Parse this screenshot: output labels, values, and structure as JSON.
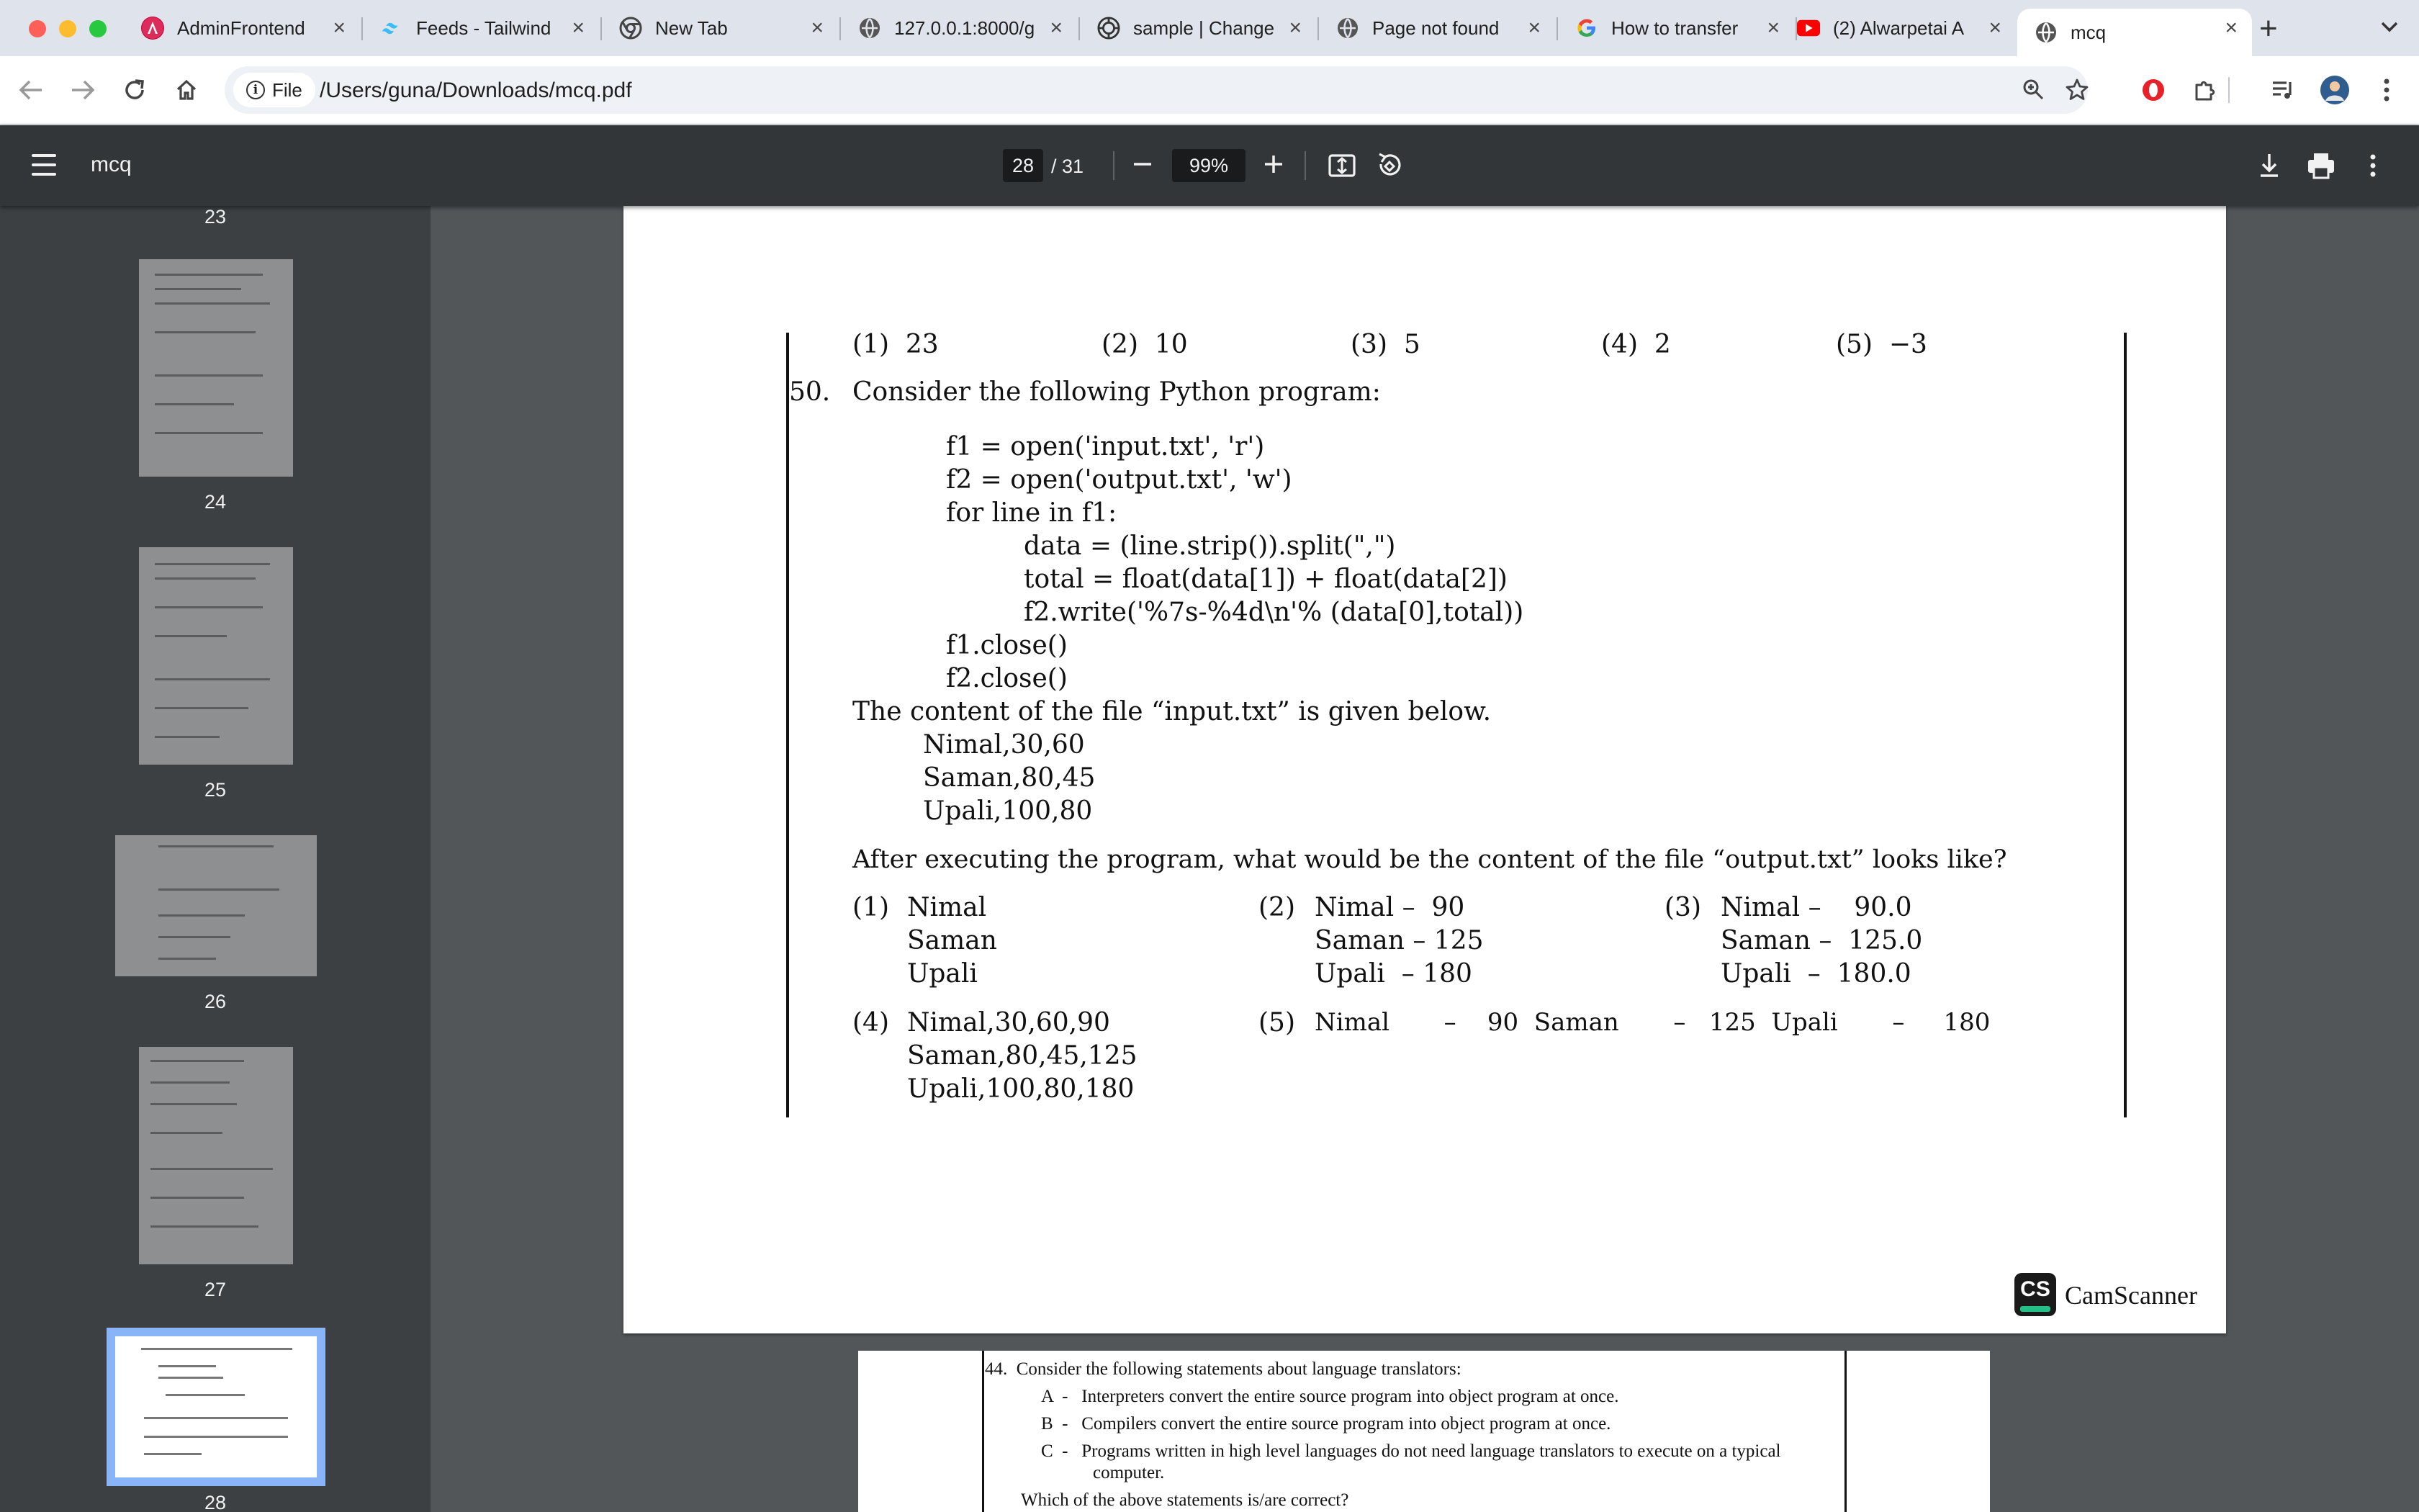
{
  "browser": {
    "tabs": [
      {
        "title": "AdminFrontend",
        "icon": "angular-icon"
      },
      {
        "title": "Feeds - Tailwind",
        "icon": "tailwind-icon"
      },
      {
        "title": "New Tab",
        "icon": "chrome-icon"
      },
      {
        "title": "127.0.0.1:8000/g",
        "icon": "globe-icon"
      },
      {
        "title": "sample | Change",
        "icon": "openai-icon"
      },
      {
        "title": "Page not found",
        "icon": "globe-icon"
      },
      {
        "title": "How to transfer",
        "icon": "google-icon"
      },
      {
        "title": "(2) Alwarpetai A",
        "icon": "youtube-icon"
      },
      {
        "title": "mcq",
        "icon": "globe-icon"
      }
    ],
    "address": {
      "chip_label": "File",
      "url": "/Users/guna/Downloads/mcq.pdf"
    }
  },
  "viewer": {
    "title": "mcq",
    "current_page": "28",
    "total_pages": "/ 31",
    "zoom": "99%"
  },
  "thumbnails": {
    "page_numbers": [
      "23",
      "24",
      "25",
      "26",
      "27",
      "28"
    ],
    "selected": "28"
  },
  "page28": {
    "prev_options": {
      "o1": "(1)  23",
      "o2": "(2)  10",
      "o3": "(3)  5",
      "o4": "(4)  2",
      "o5": "(5)  −3"
    },
    "q_num": "50.",
    "question": "Consider the following Python program:",
    "code": [
      "f1 = open('input.txt', 'r')",
      "f2 = open('output.txt', 'w')",
      "for line in f1:",
      "data = (line.strip()).split(\",\")",
      "total = float(data[1]) + float(data[2])",
      "f2.write('%7s-%4d\\n'% (data[0],total))",
      "f1.close()",
      "f2.close()"
    ],
    "content_intro": "The content of the file “input.txt” is given below.",
    "input_lines": [
      "Nimal,30,60",
      "Saman,80,45",
      "Upali,100,80"
    ],
    "after_text": "After executing the program, what would be the content of the file “output.txt” looks like?",
    "answers": {
      "a1": {
        "num": "(1)",
        "lines": [
          "Nimal",
          "Saman",
          "Upali"
        ]
      },
      "a2": {
        "num": "(2)",
        "lines": [
          "Nimal –  90",
          "Saman – 125",
          "Upali  – 180"
        ]
      },
      "a3": {
        "num": "(3)",
        "lines": [
          "Nimal –    90.0",
          "Saman –  125.0",
          "Upali  –  180.0"
        ]
      },
      "a4": {
        "num": "(4)",
        "lines": [
          "Nimal,30,60,90",
          "Saman,80,45,125",
          "Upali,100,80,180"
        ]
      },
      "a5": {
        "num": "(5)",
        "line": "Nimal       –    90  Saman       –   125  Upali       –     180"
      }
    },
    "watermark": "CamScanner",
    "watermark_logo": "CS"
  },
  "page29": {
    "q_line": "44.  Consider the following statements about language translators:",
    "a": "A  -   Interpreters convert the entire source program into object program at once.",
    "b": "B  -   Compilers convert the entire source program into object program at once.",
    "c": "C  -   Programs written in high level languages do not need language translators to execute on a typical",
    "c2": "computer.",
    "which": "Which of the above statements is/are correct?"
  }
}
